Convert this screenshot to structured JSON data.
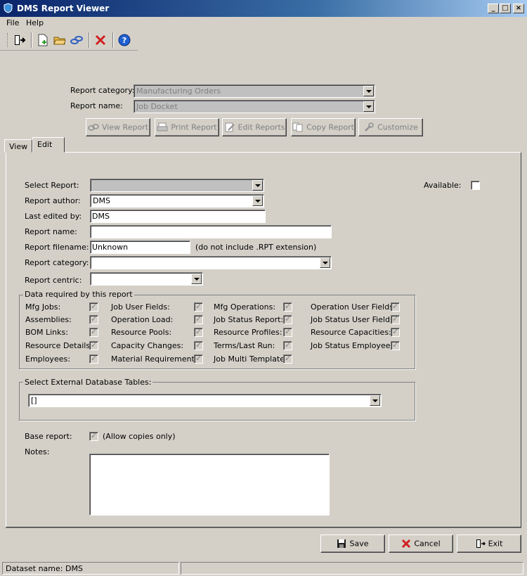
{
  "window": {
    "title": "DMS Report Viewer",
    "min": "_",
    "max": "□",
    "close": "×"
  },
  "menu": [
    "File",
    "Help"
  ],
  "header": {
    "report_category_label": "Report category:",
    "report_category_value": "Manufacturing Orders",
    "report_name_label": "Report name:",
    "report_name_value": "Job Docket",
    "buttons": [
      "View Report",
      "Print Report",
      "Edit Reports",
      "Copy Report",
      "Customize"
    ]
  },
  "tabs": [
    "View",
    "Edit"
  ],
  "form": {
    "select_report_label": "Select Report:",
    "select_report_value": "",
    "available_label": "Available:",
    "report_author_label": "Report author:",
    "report_author_value": "DMS",
    "last_edited_label": "Last edited by:",
    "last_edited_value": "DMS",
    "report_name_label": "Report name:",
    "report_name_value": "",
    "report_filename_label": "Report filename:",
    "report_filename_value": "Unknown",
    "filename_hint": "(do not include .RPT extension)",
    "report_category_label": "Report category:",
    "report_category_value": "",
    "report_centric_label": "Report centric:",
    "report_centric_value": ""
  },
  "data_required": {
    "title": "Data required by this report",
    "columns": [
      [
        "Mfg Jobs:",
        "Assemblies:",
        "BOM Links:",
        "Resource Details:",
        "Employees:"
      ],
      [
        "Job User Fields:",
        "Operation  Load:",
        "Resource Pools:",
        "Capacity Changes:",
        "Material Requirements:"
      ],
      [
        "Mfg Operations:",
        "Job Status Report:",
        "Resource Profiles:",
        "Terms/Last Run:",
        "Job Multi Template:"
      ],
      [
        "Operation User Fields:",
        "Job Status User Fields:",
        "Resource Capacities:",
        "Job Status Employees:"
      ]
    ]
  },
  "external_db": {
    "title": "Select External Database Tables:",
    "value": "[]"
  },
  "base_report": {
    "label": "Base report:",
    "checkbox_label": "(Allow copies only)"
  },
  "notes_label": "Notes:",
  "footer_buttons": {
    "save": "Save",
    "cancel": "Cancel",
    "exit": "Exit"
  },
  "status": {
    "dataset": "Dataset name:  DMS"
  }
}
